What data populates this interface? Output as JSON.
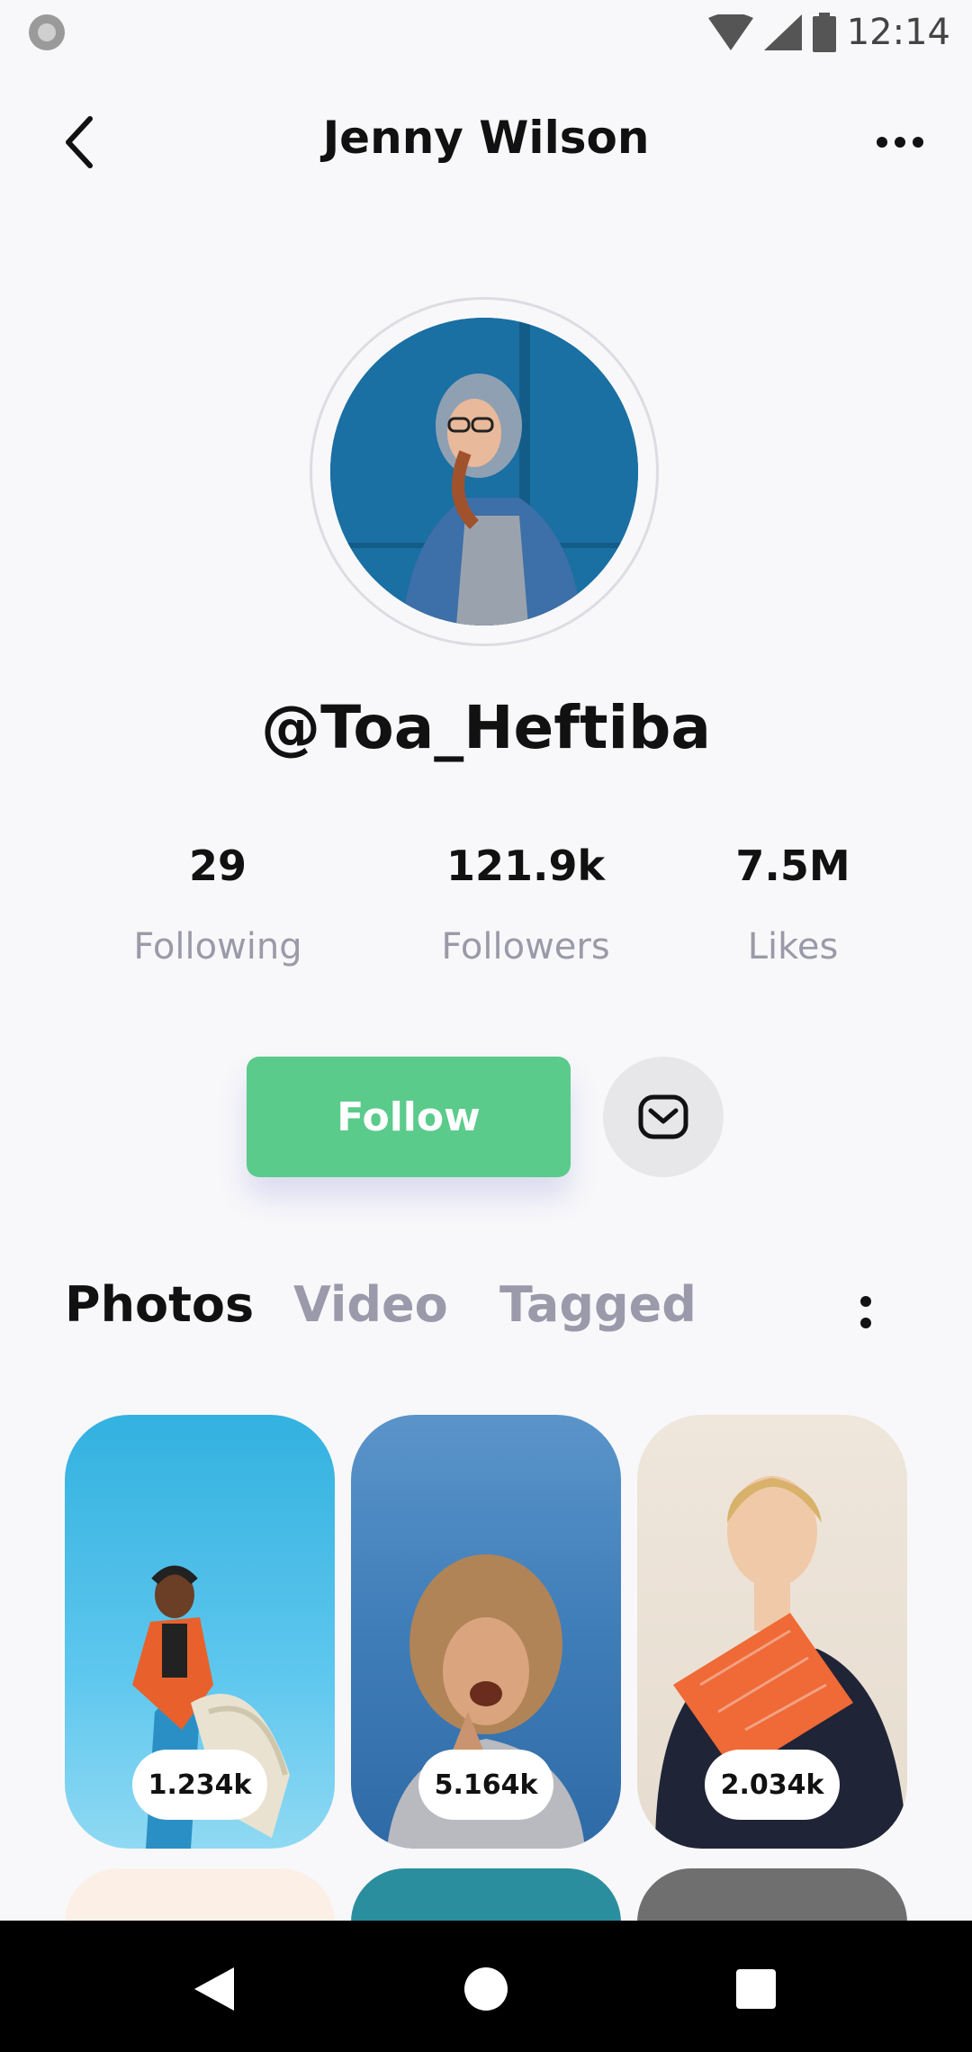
{
  "status_bar": {
    "time": "12:14"
  },
  "header": {
    "title": "Jenny Wilson"
  },
  "profile": {
    "handle": "@Toa_Heftiba"
  },
  "stats": [
    {
      "value": "29",
      "label": "Following"
    },
    {
      "value": "121.9k",
      "label": "Followers"
    },
    {
      "value": "7.5M",
      "label": "Likes"
    }
  ],
  "actions": {
    "follow_label": "Follow"
  },
  "tabs": [
    {
      "label": "Photos",
      "active": true
    },
    {
      "label": "Video",
      "active": false
    },
    {
      "label": "Tagged",
      "active": false
    }
  ],
  "photos": [
    {
      "count": "1.234k"
    },
    {
      "count": "5.164k"
    },
    {
      "count": "2.034k"
    }
  ],
  "colors": {
    "accent": "#5acb8b",
    "background": "#f8f8fa",
    "muted_text": "#9a9aa8"
  }
}
